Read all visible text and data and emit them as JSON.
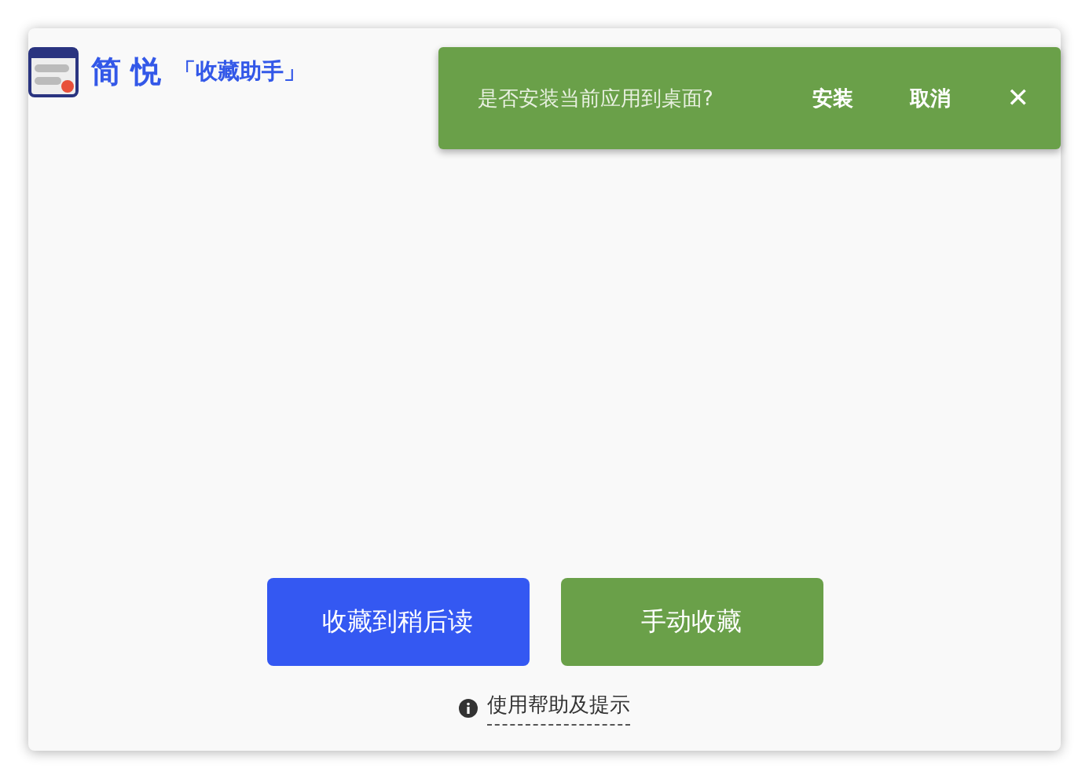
{
  "header": {
    "title": "简 悦",
    "subtitle": "「收藏助手」"
  },
  "install_prompt": {
    "message": "是否安装当前应用到桌面?",
    "actions": [
      "安装",
      "取消"
    ],
    "close": "✕"
  },
  "buttons": [
    {
      "label": "收藏到稍后读",
      "kind": "primary"
    },
    {
      "label": "手动收藏",
      "kind": "secondary"
    }
  ],
  "help_link": "使用帮助及提示"
}
